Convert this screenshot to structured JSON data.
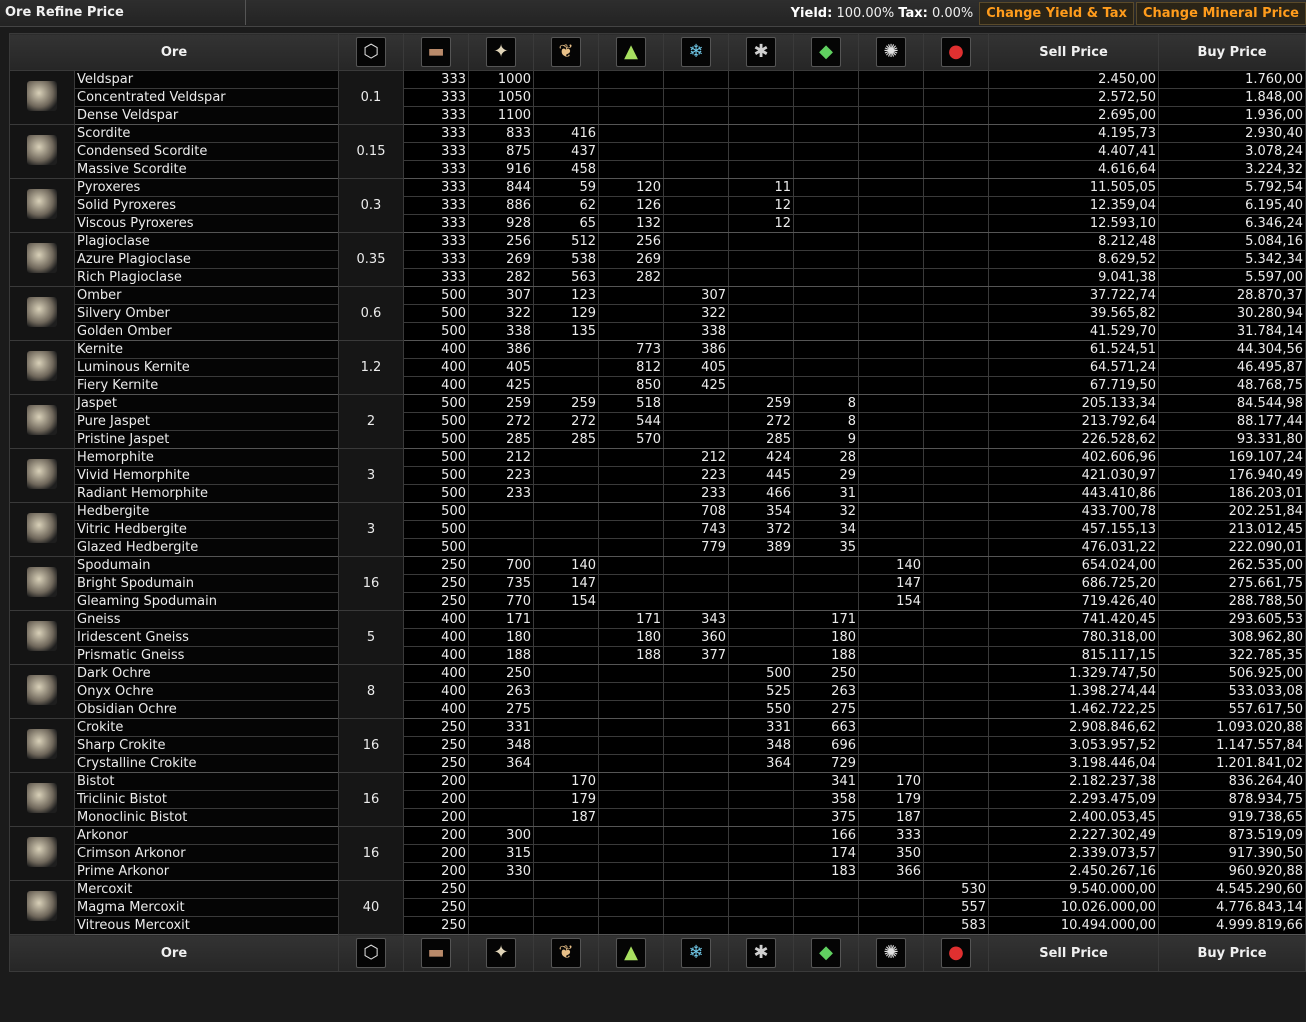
{
  "header": {
    "title": "Ore Refine Price",
    "yield_label": "Yield:",
    "yield_value": "100.00%",
    "tax_label": "Tax:",
    "tax_value": "0.00%",
    "btn_yield": "Change Yield & Tax",
    "btn_mineral": "Change Mineral Price"
  },
  "columns": {
    "ore": "Ore",
    "sell": "Sell Price",
    "buy": "Buy Price",
    "icons": [
      {
        "name": "volume-cube-icon",
        "glyph": "⬡",
        "color": "#dddddd"
      },
      {
        "name": "batch-crate-icon",
        "glyph": "▬",
        "color": "#b98a6a"
      },
      {
        "name": "tritanium-icon",
        "glyph": "✦",
        "color": "#e0d4b8"
      },
      {
        "name": "pyerite-icon",
        "glyph": "❦",
        "color": "#e8c088"
      },
      {
        "name": "mexallon-icon",
        "glyph": "▲",
        "color": "#a8e060"
      },
      {
        "name": "isogen-icon",
        "glyph": "❄",
        "color": "#70c8e8"
      },
      {
        "name": "nocxium-icon",
        "glyph": "✱",
        "color": "#d0d0d0"
      },
      {
        "name": "zydrine-icon",
        "glyph": "◆",
        "color": "#60d060"
      },
      {
        "name": "megacyte-icon",
        "glyph": "✺",
        "color": "#e0e0e0"
      },
      {
        "name": "morphite-icon",
        "glyph": "●",
        "color": "#e03030"
      }
    ]
  },
  "groups": [
    {
      "volume": "0.1",
      "rows": [
        {
          "name": "Veldspar",
          "batch": "333",
          "m": [
            "1000",
            "",
            "",
            "",
            "",
            "",
            "",
            ""
          ],
          "sell": "2.450,00",
          "buy": "1.760,00"
        },
        {
          "name": "Concentrated Veldspar",
          "batch": "333",
          "m": [
            "1050",
            "",
            "",
            "",
            "",
            "",
            "",
            ""
          ],
          "sell": "2.572,50",
          "buy": "1.848,00"
        },
        {
          "name": "Dense Veldspar",
          "batch": "333",
          "m": [
            "1100",
            "",
            "",
            "",
            "",
            "",
            "",
            ""
          ],
          "sell": "2.695,00",
          "buy": "1.936,00"
        }
      ]
    },
    {
      "volume": "0.15",
      "rows": [
        {
          "name": "Scordite",
          "batch": "333",
          "m": [
            "833",
            "416",
            "",
            "",
            "",
            "",
            "",
            ""
          ],
          "sell": "4.195,73",
          "buy": "2.930,40"
        },
        {
          "name": "Condensed Scordite",
          "batch": "333",
          "m": [
            "875",
            "437",
            "",
            "",
            "",
            "",
            "",
            ""
          ],
          "sell": "4.407,41",
          "buy": "3.078,24"
        },
        {
          "name": "Massive Scordite",
          "batch": "333",
          "m": [
            "916",
            "458",
            "",
            "",
            "",
            "",
            "",
            ""
          ],
          "sell": "4.616,64",
          "buy": "3.224,32"
        }
      ]
    },
    {
      "volume": "0.3",
      "rows": [
        {
          "name": "Pyroxeres",
          "batch": "333",
          "m": [
            "844",
            "59",
            "120",
            "",
            "11",
            "",
            "",
            ""
          ],
          "sell": "11.505,05",
          "buy": "5.792,54"
        },
        {
          "name": "Solid Pyroxeres",
          "batch": "333",
          "m": [
            "886",
            "62",
            "126",
            "",
            "12",
            "",
            "",
            ""
          ],
          "sell": "12.359,04",
          "buy": "6.195,40"
        },
        {
          "name": "Viscous Pyroxeres",
          "batch": "333",
          "m": [
            "928",
            "65",
            "132",
            "",
            "12",
            "",
            "",
            ""
          ],
          "sell": "12.593,10",
          "buy": "6.346,24"
        }
      ]
    },
    {
      "volume": "0.35",
      "rows": [
        {
          "name": "Plagioclase",
          "batch": "333",
          "m": [
            "256",
            "512",
            "256",
            "",
            "",
            "",
            "",
            ""
          ],
          "sell": "8.212,48",
          "buy": "5.084,16"
        },
        {
          "name": "Azure Plagioclase",
          "batch": "333",
          "m": [
            "269",
            "538",
            "269",
            "",
            "",
            "",
            "",
            ""
          ],
          "sell": "8.629,52",
          "buy": "5.342,34"
        },
        {
          "name": "Rich Plagioclase",
          "batch": "333",
          "m": [
            "282",
            "563",
            "282",
            "",
            "",
            "",
            "",
            ""
          ],
          "sell": "9.041,38",
          "buy": "5.597,00"
        }
      ]
    },
    {
      "volume": "0.6",
      "rows": [
        {
          "name": "Omber",
          "batch": "500",
          "m": [
            "307",
            "123",
            "",
            "307",
            "",
            "",
            "",
            ""
          ],
          "sell": "37.722,74",
          "buy": "28.870,37"
        },
        {
          "name": "Silvery Omber",
          "batch": "500",
          "m": [
            "322",
            "129",
            "",
            "322",
            "",
            "",
            "",
            ""
          ],
          "sell": "39.565,82",
          "buy": "30.280,94"
        },
        {
          "name": "Golden Omber",
          "batch": "500",
          "m": [
            "338",
            "135",
            "",
            "338",
            "",
            "",
            "",
            ""
          ],
          "sell": "41.529,70",
          "buy": "31.784,14"
        }
      ]
    },
    {
      "volume": "1.2",
      "rows": [
        {
          "name": "Kernite",
          "batch": "400",
          "m": [
            "386",
            "",
            "773",
            "386",
            "",
            "",
            "",
            ""
          ],
          "sell": "61.524,51",
          "buy": "44.304,56"
        },
        {
          "name": "Luminous Kernite",
          "batch": "400",
          "m": [
            "405",
            "",
            "812",
            "405",
            "",
            "",
            "",
            ""
          ],
          "sell": "64.571,24",
          "buy": "46.495,87"
        },
        {
          "name": "Fiery Kernite",
          "batch": "400",
          "m": [
            "425",
            "",
            "850",
            "425",
            "",
            "",
            "",
            ""
          ],
          "sell": "67.719,50",
          "buy": "48.768,75"
        }
      ]
    },
    {
      "volume": "2",
      "rows": [
        {
          "name": "Jaspet",
          "batch": "500",
          "m": [
            "259",
            "259",
            "518",
            "",
            "259",
            "8",
            "",
            ""
          ],
          "sell": "205.133,34",
          "buy": "84.544,98"
        },
        {
          "name": "Pure Jaspet",
          "batch": "500",
          "m": [
            "272",
            "272",
            "544",
            "",
            "272",
            "8",
            "",
            ""
          ],
          "sell": "213.792,64",
          "buy": "88.177,44"
        },
        {
          "name": "Pristine Jaspet",
          "batch": "500",
          "m": [
            "285",
            "285",
            "570",
            "",
            "285",
            "9",
            "",
            ""
          ],
          "sell": "226.528,62",
          "buy": "93.331,80"
        }
      ]
    },
    {
      "volume": "3",
      "rows": [
        {
          "name": "Hemorphite",
          "batch": "500",
          "m": [
            "212",
            "",
            "",
            "212",
            "424",
            "28",
            "",
            ""
          ],
          "sell": "402.606,96",
          "buy": "169.107,24"
        },
        {
          "name": "Vivid Hemorphite",
          "batch": "500",
          "m": [
            "223",
            "",
            "",
            "223",
            "445",
            "29",
            "",
            ""
          ],
          "sell": "421.030,97",
          "buy": "176.940,49"
        },
        {
          "name": "Radiant Hemorphite",
          "batch": "500",
          "m": [
            "233",
            "",
            "",
            "233",
            "466",
            "31",
            "",
            ""
          ],
          "sell": "443.410,86",
          "buy": "186.203,01"
        }
      ]
    },
    {
      "volume": "3",
      "rows": [
        {
          "name": "Hedbergite",
          "batch": "500",
          "m": [
            "",
            "",
            "",
            "708",
            "354",
            "32",
            "",
            ""
          ],
          "sell": "433.700,78",
          "buy": "202.251,84"
        },
        {
          "name": "Vitric Hedbergite",
          "batch": "500",
          "m": [
            "",
            "",
            "",
            "743",
            "372",
            "34",
            "",
            ""
          ],
          "sell": "457.155,13",
          "buy": "213.012,45"
        },
        {
          "name": "Glazed Hedbergite",
          "batch": "500",
          "m": [
            "",
            "",
            "",
            "779",
            "389",
            "35",
            "",
            ""
          ],
          "sell": "476.031,22",
          "buy": "222.090,01"
        }
      ]
    },
    {
      "volume": "16",
      "rows": [
        {
          "name": "Spodumain",
          "batch": "250",
          "m": [
            "700",
            "140",
            "",
            "",
            "",
            "",
            "140",
            ""
          ],
          "sell": "654.024,00",
          "buy": "262.535,00"
        },
        {
          "name": "Bright Spodumain",
          "batch": "250",
          "m": [
            "735",
            "147",
            "",
            "",
            "",
            "",
            "147",
            ""
          ],
          "sell": "686.725,20",
          "buy": "275.661,75"
        },
        {
          "name": "Gleaming Spodumain",
          "batch": "250",
          "m": [
            "770",
            "154",
            "",
            "",
            "",
            "",
            "154",
            ""
          ],
          "sell": "719.426,40",
          "buy": "288.788,50"
        }
      ]
    },
    {
      "volume": "5",
      "rows": [
        {
          "name": "Gneiss",
          "batch": "400",
          "m": [
            "171",
            "",
            "171",
            "343",
            "",
            "171",
            "",
            ""
          ],
          "sell": "741.420,45",
          "buy": "293.605,53"
        },
        {
          "name": "Iridescent Gneiss",
          "batch": "400",
          "m": [
            "180",
            "",
            "180",
            "360",
            "",
            "180",
            "",
            ""
          ],
          "sell": "780.318,00",
          "buy": "308.962,80"
        },
        {
          "name": "Prismatic Gneiss",
          "batch": "400",
          "m": [
            "188",
            "",
            "188",
            "377",
            "",
            "188",
            "",
            ""
          ],
          "sell": "815.117,15",
          "buy": "322.785,35"
        }
      ]
    },
    {
      "volume": "8",
      "rows": [
        {
          "name": "Dark Ochre",
          "batch": "400",
          "m": [
            "250",
            "",
            "",
            "",
            "500",
            "250",
            "",
            ""
          ],
          "sell": "1.329.747,50",
          "buy": "506.925,00"
        },
        {
          "name": "Onyx Ochre",
          "batch": "400",
          "m": [
            "263",
            "",
            "",
            "",
            "525",
            "263",
            "",
            ""
          ],
          "sell": "1.398.274,44",
          "buy": "533.033,08"
        },
        {
          "name": "Obsidian Ochre",
          "batch": "400",
          "m": [
            "275",
            "",
            "",
            "",
            "550",
            "275",
            "",
            ""
          ],
          "sell": "1.462.722,25",
          "buy": "557.617,50"
        }
      ]
    },
    {
      "volume": "16",
      "rows": [
        {
          "name": "Crokite",
          "batch": "250",
          "m": [
            "331",
            "",
            "",
            "",
            "331",
            "663",
            "",
            ""
          ],
          "sell": "2.908.846,62",
          "buy": "1.093.020,88"
        },
        {
          "name": "Sharp Crokite",
          "batch": "250",
          "m": [
            "348",
            "",
            "",
            "",
            "348",
            "696",
            "",
            ""
          ],
          "sell": "3.053.957,52",
          "buy": "1.147.557,84"
        },
        {
          "name": "Crystalline Crokite",
          "batch": "250",
          "m": [
            "364",
            "",
            "",
            "",
            "364",
            "729",
            "",
            ""
          ],
          "sell": "3.198.446,04",
          "buy": "1.201.841,02"
        }
      ]
    },
    {
      "volume": "16",
      "rows": [
        {
          "name": "Bistot",
          "batch": "200",
          "m": [
            "",
            "170",
            "",
            "",
            "",
            "341",
            "170",
            ""
          ],
          "sell": "2.182.237,38",
          "buy": "836.264,40"
        },
        {
          "name": "Triclinic Bistot",
          "batch": "200",
          "m": [
            "",
            "179",
            "",
            "",
            "",
            "358",
            "179",
            ""
          ],
          "sell": "2.293.475,09",
          "buy": "878.934,75"
        },
        {
          "name": "Monoclinic Bistot",
          "batch": "200",
          "m": [
            "",
            "187",
            "",
            "",
            "",
            "375",
            "187",
            ""
          ],
          "sell": "2.400.053,45",
          "buy": "919.738,65"
        }
      ]
    },
    {
      "volume": "16",
      "rows": [
        {
          "name": "Arkonor",
          "batch": "200",
          "m": [
            "300",
            "",
            "",
            "",
            "",
            "166",
            "333",
            ""
          ],
          "sell": "2.227.302,49",
          "buy": "873.519,09"
        },
        {
          "name": "Crimson Arkonor",
          "batch": "200",
          "m": [
            "315",
            "",
            "",
            "",
            "",
            "174",
            "350",
            ""
          ],
          "sell": "2.339.073,57",
          "buy": "917.390,50"
        },
        {
          "name": "Prime Arkonor",
          "batch": "200",
          "m": [
            "330",
            "",
            "",
            "",
            "",
            "183",
            "366",
            ""
          ],
          "sell": "2.450.267,16",
          "buy": "960.920,88"
        }
      ]
    },
    {
      "volume": "40",
      "rows": [
        {
          "name": "Mercoxit",
          "batch": "250",
          "m": [
            "",
            "",
            "",
            "",
            "",
            "",
            "",
            "530"
          ],
          "sell": "9.540.000,00",
          "buy": "4.545.290,60"
        },
        {
          "name": "Magma Mercoxit",
          "batch": "250",
          "m": [
            "",
            "",
            "",
            "",
            "",
            "",
            "",
            "557"
          ],
          "sell": "10.026.000,00",
          "buy": "4.776.843,14"
        },
        {
          "name": "Vitreous Mercoxit",
          "batch": "250",
          "m": [
            "",
            "",
            "",
            "",
            "",
            "",
            "",
            "583"
          ],
          "sell": "10.494.000,00",
          "buy": "4.999.819,66"
        }
      ]
    }
  ]
}
